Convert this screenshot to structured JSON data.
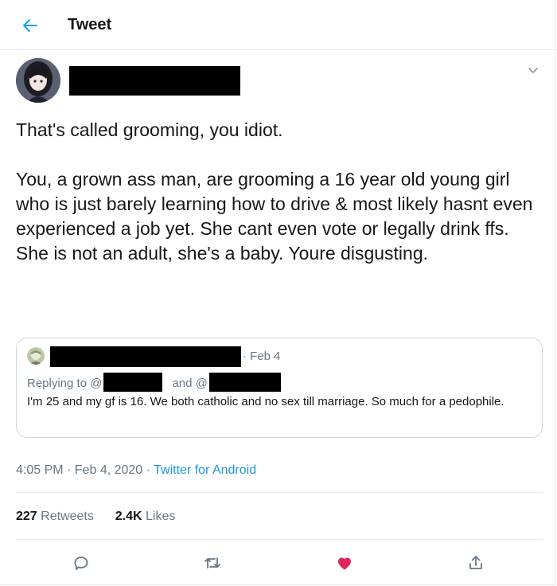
{
  "colors": {
    "accent": "#1da1f2",
    "link": "#1b95e0",
    "like": "#e0245e",
    "muted": "#657786",
    "border": "#e6ecf0"
  },
  "header": {
    "back_icon": "arrow-left-icon",
    "title": "Tweet"
  },
  "tweet": {
    "username_redacted": true,
    "menu_icon": "chevron-down-icon",
    "paragraphs": [
      "That's called grooming, you idiot.",
      "You, a grown ass man, are grooming a 16 year old young girl who is just barely learning how to drive & most likely hasnt even experienced a job yet. She cant even vote or legally drink ffs. She is not an adult, she's a baby. Youre disgusting."
    ],
    "quoted": {
      "date": "· Feb 4",
      "replying_prefix": "Replying to @",
      "replying_and": "and @",
      "text": "I'm 25 and my gf is 16. We both catholic and no sex till marriage. So much for a pedophile."
    },
    "timestamp": "4:05 PM · Feb 4, 2020 · ",
    "source": "Twitter for Android",
    "retweets_count": "227",
    "retweets_label": " Retweets",
    "likes_count": "2.4K",
    "likes_label": " Likes"
  },
  "actions": {
    "reply_icon": "comment-icon",
    "retweet_icon": "retweet-icon",
    "like_icon": "heart-icon",
    "share_icon": "share-icon"
  }
}
